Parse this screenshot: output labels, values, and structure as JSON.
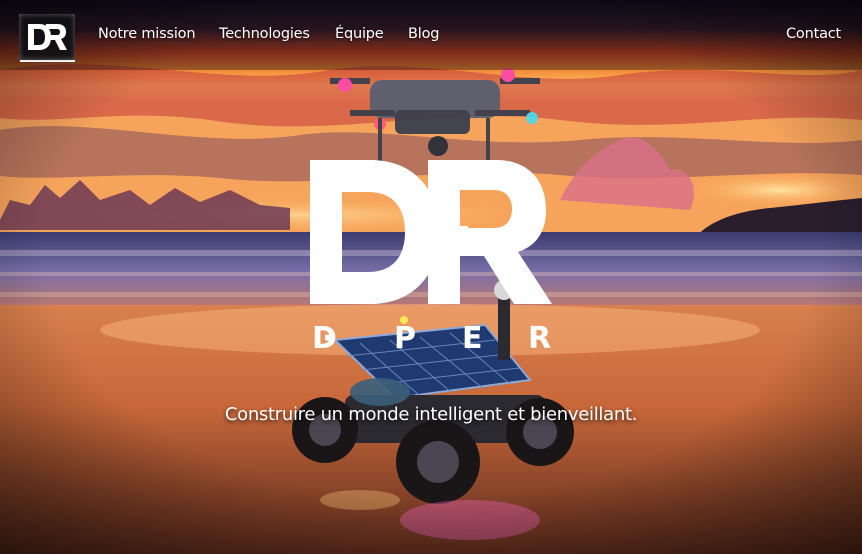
{
  "nav": {
    "logo_text": "DR",
    "links": [
      "Notre mission",
      "Technologies",
      "Équipe",
      "Blog"
    ],
    "contact_label": "Contact"
  },
  "hero": {
    "brand_letters": "DR",
    "brand_sub": [
      "D",
      "P",
      "E",
      "R"
    ],
    "tagline": "Construire un monde intelligent et bienveillant."
  },
  "colors": {
    "nav_text": "#ffffff",
    "logo_bg": "#0f0f14",
    "sky_top": "#1a1733",
    "sunset": "#ff8a2a"
  }
}
